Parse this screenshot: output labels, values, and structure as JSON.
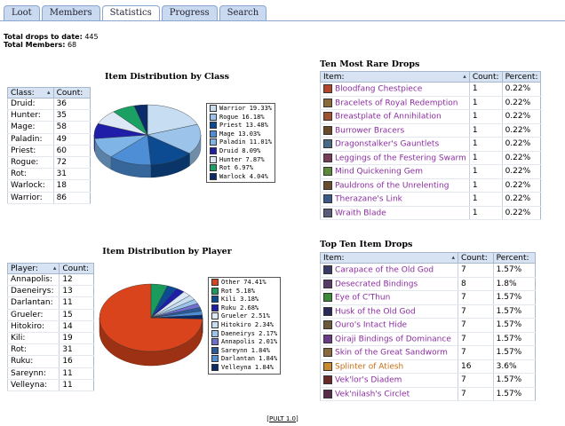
{
  "tabs": [
    {
      "label": "Loot",
      "active": false
    },
    {
      "label": "Members",
      "active": false
    },
    {
      "label": "Statistics",
      "active": true
    },
    {
      "label": "Progress",
      "active": false
    },
    {
      "label": "Search",
      "active": false
    }
  ],
  "totals": {
    "drops_label": "Total drops to date:",
    "drops_value": "445",
    "members_label": "Total Members:",
    "members_value": "68"
  },
  "class_table": {
    "headers": [
      "Class:",
      "Count:"
    ],
    "rows": [
      [
        "Druid:",
        "36"
      ],
      [
        "Hunter:",
        "35"
      ],
      [
        "Mage:",
        "58"
      ],
      [
        "Paladin:",
        "49"
      ],
      [
        "Priest:",
        "60"
      ],
      [
        "Rogue:",
        "72"
      ],
      [
        "Rot:",
        "31"
      ],
      [
        "Warlock:",
        "18"
      ],
      [
        "Warrior:",
        "86"
      ]
    ]
  },
  "player_table": {
    "headers": [
      "Player:",
      "Count:"
    ],
    "rows": [
      [
        "Annapolis:",
        "12"
      ],
      [
        "Daeneirys:",
        "13"
      ],
      [
        "Darlantan:",
        "11"
      ],
      [
        "Grueler:",
        "15"
      ],
      [
        "Hitokiro:",
        "14"
      ],
      [
        "Kili:",
        "19"
      ],
      [
        "Rot:",
        "31"
      ],
      [
        "Ruku:",
        "16"
      ],
      [
        "Sareynn:",
        "11"
      ],
      [
        "Velleyna:",
        "11"
      ]
    ]
  },
  "rare_drops": {
    "title": "Ten Most Rare Drops",
    "headers": [
      "Item:",
      "Count:",
      "Percent:"
    ],
    "rows": [
      {
        "item": "Bloodfang Chestpiece",
        "count": "1",
        "percent": "0.22%",
        "color": "#8a2e9e",
        "icon": "#b4442c"
      },
      {
        "item": "Bracelets of Royal Redemption",
        "count": "1",
        "percent": "0.22%",
        "color": "#8a2e9e",
        "icon": "#8a6a3a"
      },
      {
        "item": "Breastplate of Annihilation",
        "count": "1",
        "percent": "0.22%",
        "color": "#8a2e9e",
        "icon": "#a0522d"
      },
      {
        "item": "Burrower Bracers",
        "count": "1",
        "percent": "0.22%",
        "color": "#8a2e9e",
        "icon": "#6b4a2a"
      },
      {
        "item": "Dragonstalker's Gauntlets",
        "count": "1",
        "percent": "0.22%",
        "color": "#8a2e9e",
        "icon": "#4a6a8a"
      },
      {
        "item": "Leggings of the Festering Swarm",
        "count": "1",
        "percent": "0.22%",
        "color": "#8a2e9e",
        "icon": "#7a3a5a"
      },
      {
        "item": "Mind Quickening Gem",
        "count": "1",
        "percent": "0.22%",
        "color": "#8a2e9e",
        "icon": "#5a8a3a"
      },
      {
        "item": "Pauldrons of the Unrelenting",
        "count": "1",
        "percent": "0.22%",
        "color": "#8a2e9e",
        "icon": "#6a4a2a"
      },
      {
        "item": "Therazane's Link",
        "count": "1",
        "percent": "0.22%",
        "color": "#8a2e9e",
        "icon": "#3a5a8a"
      },
      {
        "item": "Wraith Blade",
        "count": "1",
        "percent": "0.22%",
        "color": "#8a2e9e",
        "icon": "#5a5a7a"
      }
    ]
  },
  "top_drops": {
    "title": "Top Ten Item Drops",
    "headers": [
      "Item:",
      "Count:",
      "Percent:"
    ],
    "rows": [
      {
        "item": "Carapace of the Old God",
        "count": "7",
        "percent": "1.57%",
        "color": "#8a2e9e",
        "icon": "#3a3a6a"
      },
      {
        "item": "Desecrated Bindings",
        "count": "8",
        "percent": "1.8%",
        "color": "#8a2e9e",
        "icon": "#5a3a6a"
      },
      {
        "item": "Eye of C'Thun",
        "count": "7",
        "percent": "1.57%",
        "color": "#8a2e9e",
        "icon": "#3a8a3a"
      },
      {
        "item": "Husk of the Old God",
        "count": "7",
        "percent": "1.57%",
        "color": "#8a2e9e",
        "icon": "#2a2a5a"
      },
      {
        "item": "Ouro's Intact Hide",
        "count": "7",
        "percent": "1.57%",
        "color": "#8a2e9e",
        "icon": "#6a5a3a"
      },
      {
        "item": "Qiraji Bindings of Dominance",
        "count": "7",
        "percent": "1.57%",
        "color": "#8a2e9e",
        "icon": "#6a3a8a"
      },
      {
        "item": "Skin of the Great Sandworm",
        "count": "7",
        "percent": "1.57%",
        "color": "#8a2e9e",
        "icon": "#8a6a3a"
      },
      {
        "item": "Splinter of Atiesh",
        "count": "16",
        "percent": "3.6%",
        "color": "#c76d12",
        "icon": "#c88a2a"
      },
      {
        "item": "Vek'lor's Diadem",
        "count": "7",
        "percent": "1.57%",
        "color": "#8a2e9e",
        "icon": "#6a2a2a"
      },
      {
        "item": "Vek'nilash's Circlet",
        "count": "7",
        "percent": "1.57%",
        "color": "#8a2e9e",
        "icon": "#5a2a4a"
      }
    ]
  },
  "chart_data": [
    {
      "type": "pie",
      "title": "Item Distribution by Class",
      "legend_position": "right",
      "slices": [
        {
          "label": "Warrior",
          "percent": 19.33,
          "legend": "Warrior 19.33%",
          "color": "#c6ddf2"
        },
        {
          "label": "Rogue",
          "percent": 16.18,
          "legend": "Rogue 16.18%",
          "color": "#9cc4ea"
        },
        {
          "label": "Priest",
          "percent": 13.48,
          "legend": "Priest 13.48%",
          "color": "#0c4a92"
        },
        {
          "label": "Mage",
          "percent": 13.03,
          "legend": "Mage 13.03%",
          "color": "#4d8ed6"
        },
        {
          "label": "Paladin",
          "percent": 11.01,
          "legend": "Paladin 11.01%",
          "color": "#7fb4e6"
        },
        {
          "label": "Druid",
          "percent": 8.09,
          "legend": "Druid 8.09%",
          "color": "#1e1ea8"
        },
        {
          "label": "Hunter",
          "percent": 7.87,
          "legend": "Hunter 7.87%",
          "color": "#dde8f6"
        },
        {
          "label": "Rot",
          "percent": 6.97,
          "legend": "Rot 6.97%",
          "color": "#1aa063"
        },
        {
          "label": "Warlock",
          "percent": 4.04,
          "legend": "Warlock 4.04%",
          "color": "#0a2a6a"
        }
      ]
    },
    {
      "type": "pie",
      "title": "Item Distribution by Player",
      "legend_position": "right",
      "slices": [
        {
          "label": "Other",
          "percent": 74.41,
          "legend": "Other 74.41%",
          "color": "#d9441c"
        },
        {
          "label": "Rot",
          "percent": 5.18,
          "legend": "Rot 5.18%",
          "color": "#1a9a5c"
        },
        {
          "label": "Kili",
          "percent": 3.18,
          "legend": "Kili 3.18%",
          "color": "#0c4a92"
        },
        {
          "label": "Ruku",
          "percent": 2.68,
          "legend": "Ruku 2.68%",
          "color": "#1e1ea8"
        },
        {
          "label": "Grueler",
          "percent": 2.51,
          "legend": "Grueler 2.51%",
          "color": "#dde8f6"
        },
        {
          "label": "Hitokiro",
          "percent": 2.34,
          "legend": "Hitokiro 2.34%",
          "color": "#c6ddf2"
        },
        {
          "label": "Daeneirys",
          "percent": 2.17,
          "legend": "Daeneirys 2.17%",
          "color": "#9cc4ea"
        },
        {
          "label": "Annapolis",
          "percent": 2.01,
          "legend": "Annapolis 2.01%",
          "color": "#6f6fd0"
        },
        {
          "label": "Sareynn",
          "percent": 1.84,
          "legend": "Sareynn 1.84%",
          "color": "#2a5a9a"
        },
        {
          "label": "Darlantan",
          "percent": 1.84,
          "legend": "Darlantan 1.84%",
          "color": "#4d8ed6"
        },
        {
          "label": "Velleyna",
          "percent": 1.84,
          "legend": "Velleyna 1.84%",
          "color": "#0a2a6a"
        }
      ]
    }
  ],
  "footer": {
    "label": "PULT 1.0"
  }
}
